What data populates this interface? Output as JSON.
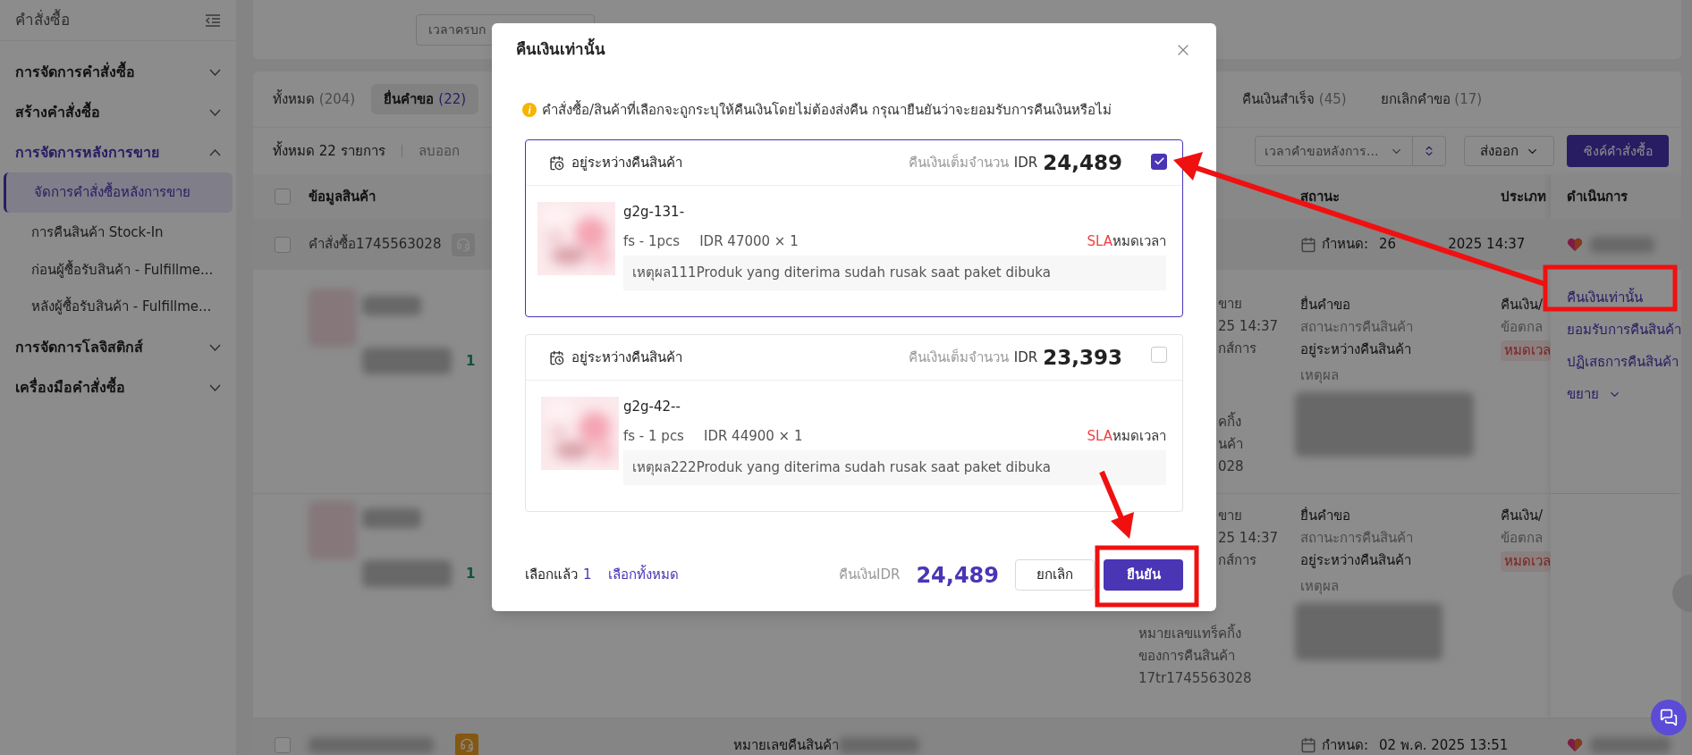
{
  "sidebar": {
    "title": "คำสั่งซื้อ",
    "items": [
      {
        "label": "การจัดการคำสั่งซื้อ",
        "expanded": false,
        "selected": false
      },
      {
        "label": "สร้างคำสั่งซื้อ",
        "expanded": false,
        "selected": false
      },
      {
        "label": "การจัดการหลังการขาย",
        "expanded": true,
        "selected": true,
        "children": [
          {
            "label": "จัดการคำสั่งซื้อหลังการขาย",
            "selected": true
          },
          {
            "label": "การคืนสินค้า Stock-In",
            "selected": false
          },
          {
            "label": "ก่อนผู้ซื้อรับสินค้า - Fulfillme...",
            "selected": false
          },
          {
            "label": "หลังผู้ซื้อรับสินค้า - Fulfillme...",
            "selected": false
          }
        ]
      },
      {
        "label": "การจัดการโลจิสติกส์",
        "expanded": false,
        "selected": false
      },
      {
        "label": "เครื่องมือคำสั่งซื้อ",
        "expanded": false,
        "selected": false
      }
    ]
  },
  "filters": {
    "field": "เวลาครบก"
  },
  "tabs": [
    {
      "label": "ทั้งหมด",
      "count": "(204)",
      "selected": false
    },
    {
      "label": "ยื่นคำขอ",
      "count": "(22)",
      "selected": true
    },
    {
      "label": "คืนเงินสำเร็จ",
      "count": "(45)",
      "selected": false
    },
    {
      "label": "ยกเลิกคำขอ",
      "count": "(17)",
      "selected": false
    }
  ],
  "toolbar": {
    "total": "ทั้งหมด 22 รายการ",
    "remove": "ลบออก",
    "sort_field": "เวลาคำขอหลังการ...",
    "export": "ส่งออก",
    "sync": "ซิงค์คำสั่งซื้อ"
  },
  "table": {
    "header_checked": false,
    "columns": [
      "ข้อมูลสินค้า",
      "สถานะ",
      "ประเภท",
      "ดำเนินการ"
    ],
    "order": {
      "checked": false,
      "number": "คำสั่งซื้อ1745563028",
      "deadline_label": "กำหนด:",
      "deadline": "26",
      "deadline_rest": "2025 14:37"
    },
    "rows": [
      {
        "quantity": "1",
        "column_a": [
          "ขาย",
          "25 14:37",
          "กส์การ"
        ],
        "column_a_more": [
          "คกิ้ง",
          "นค้า",
          "028"
        ],
        "status": "ยื่นคำขอ",
        "status_label": "สถานะการคืนสินค้า",
        "status_value": "อยู่ระหว่างคืนสินค้า",
        "reason_label": "เหตุผล",
        "type": "คืนเงิน/",
        "type_note": "ข้อตกล",
        "type_tag": "หมดเวล",
        "actions": [
          "คืนเงินเท่านั้น",
          "ยอมรับการคืนสินค้า",
          "ปฏิเสธการคืนสินค้า",
          "ขยาย"
        ]
      },
      {
        "quantity": "1",
        "column_a": [
          "ขาย",
          "25 14:37",
          "กส์การ"
        ],
        "column_a_full": [
          "หมายเลขแทร็คกิ้ง",
          "ของการคืนสินค้า",
          "17tr1745563028"
        ],
        "status": "ยื่นคำขอ",
        "status_label": "สถานะการคืนสินค้า",
        "status_value": "อยู่ระหว่างคืนสินค้า",
        "reason_label": "เหตุผล",
        "type": "คืนเงิน/",
        "type_note": "ข้อตกล",
        "type_tag": "หมดเวล"
      }
    ],
    "next_order": {
      "checked": false,
      "return_label": "หมายเลขคืนสินค้า",
      "deadline_label": "กำหนด:",
      "deadline": "02 พ.ค. 2025 13:51"
    }
  },
  "modal": {
    "title": "คืนเงินเท่านั้น",
    "notice": "คำสั่งซื้อ/สินค้าที่เลือกจะถูกระบุให้คืนเงินโดยไม่ต้องส่งคืน กรุณายืนยันว่าจะยอมรับการคืนเงินหรือไม่",
    "items": [
      {
        "status": "อยู่ระหว่างคืนสินค้า",
        "refund_label": "คืนเงินเต็มจำนวน",
        "currency": "IDR",
        "amount": "24,489",
        "checked": true,
        "name": "g2g-131-",
        "variant": "fs - 1pcs",
        "price": "IDR 47000 × 1",
        "sla": "SLA",
        "sla_status": "หมดเวลา",
        "reason": "เหตุผล111Produk yang diterima sudah rusak saat paket dibuka"
      },
      {
        "status": "อยู่ระหว่างคืนสินค้า",
        "refund_label": "คืนเงินเต็มจำนวน",
        "currency": "IDR",
        "amount": "23,393",
        "checked": false,
        "name": "g2g-42--",
        "variant": "fs - 1 pcs",
        "price": "IDR 44900 × 1",
        "sla": "SLA",
        "sla_status": "หมดเวลา",
        "reason": "เหตุผล222Produk yang diterima sudah rusak saat paket dibuka"
      }
    ],
    "footer": {
      "selected_label": "เลือกแล้ว",
      "selected_count": "1",
      "select_all": "เลือกทั้งหมด",
      "refund_label": "คืนเงินIDR",
      "refund_total": "24,489",
      "cancel": "ยกเลิก",
      "confirm": "ยืนยัน"
    }
  }
}
